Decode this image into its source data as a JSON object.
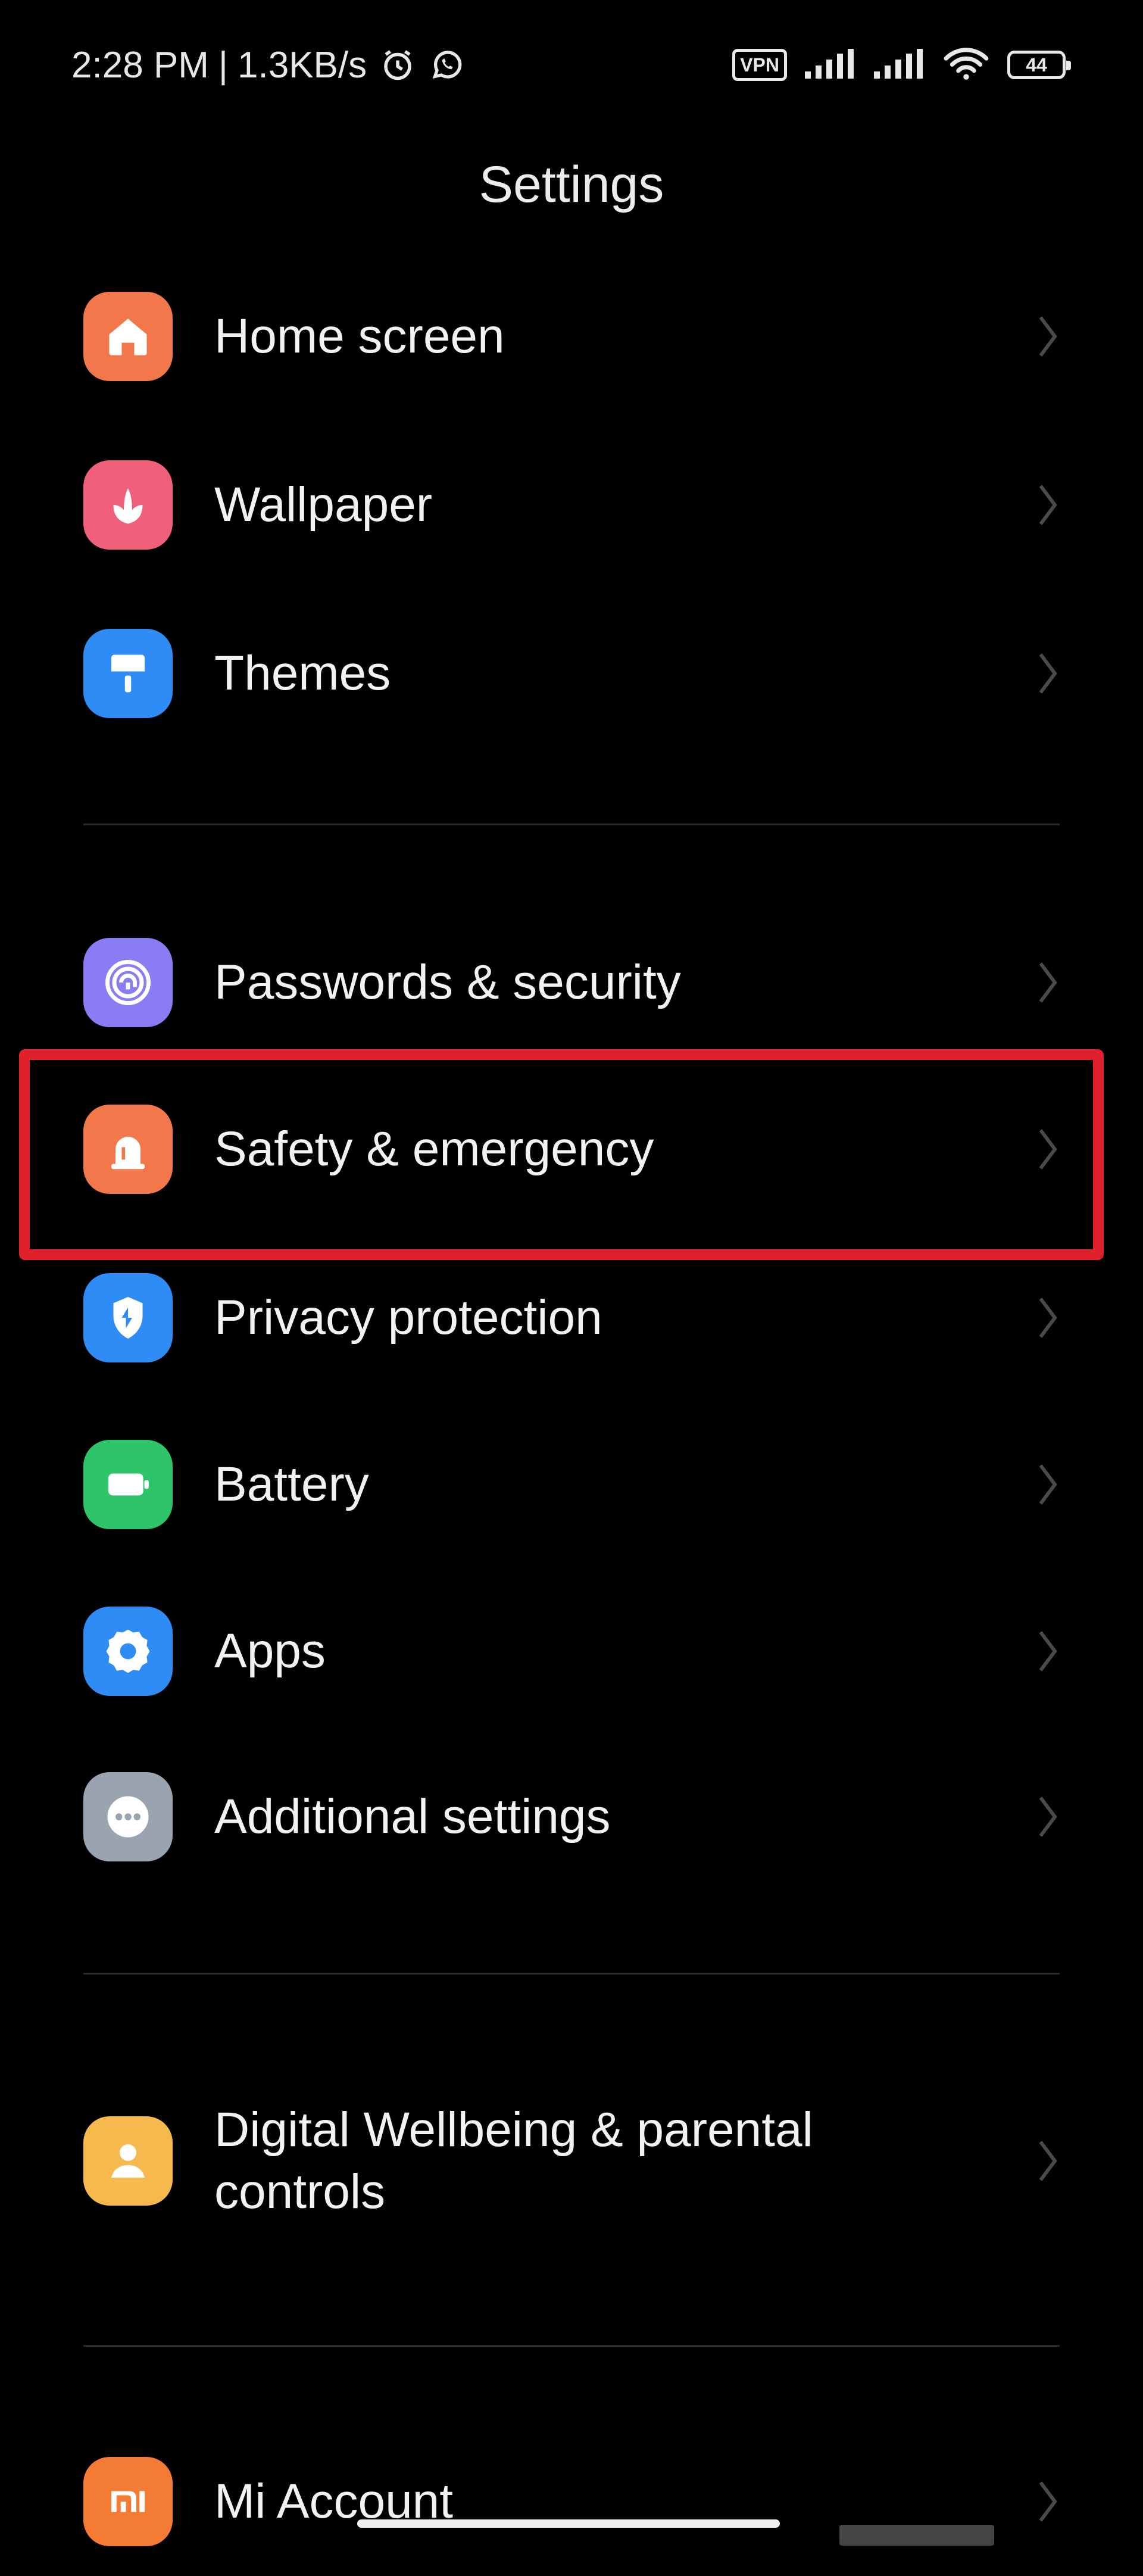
{
  "status_bar": {
    "time": "2:28 PM",
    "separator": "|",
    "network_speed": "1.3KB/s",
    "alarm_icon": "alarm-clock-icon",
    "whatsapp_icon": "whatsapp-icon",
    "vpn_label": "VPN",
    "battery_level": "44"
  },
  "header": {
    "title": "Settings"
  },
  "settings": [
    {
      "label": "Home screen",
      "icon": "home-icon",
      "color": "#f2784b"
    },
    {
      "label": "Wallpaper",
      "icon": "flower-icon",
      "color": "#f0607a"
    },
    {
      "label": "Themes",
      "icon": "paint-brush-icon",
      "color": "#2f8cf5"
    },
    {
      "label": "Passwords & security",
      "icon": "fingerprint-icon",
      "color": "#8a7cf2"
    },
    {
      "label": "Safety & emergency",
      "icon": "emergency-light-icon",
      "color": "#f2784b"
    },
    {
      "label": "Privacy protection",
      "icon": "privacy-shield-icon",
      "color": "#2f8cf5"
    },
    {
      "label": "Battery",
      "icon": "battery-icon",
      "color": "#2ec46a"
    },
    {
      "label": "Apps",
      "icon": "gear-icon",
      "color": "#2f8cf5"
    },
    {
      "label": "Additional settings",
      "icon": "more-dots-icon",
      "color": "#9aa4b0"
    },
    {
      "label": "Digital Wellbeing & parental controls",
      "icon": "person-icon",
      "color": "#f5b94d"
    },
    {
      "label": "Mi Account",
      "icon": "mi-logo-icon",
      "color": "#f47b34"
    }
  ],
  "highlight_color": "#e0212b"
}
